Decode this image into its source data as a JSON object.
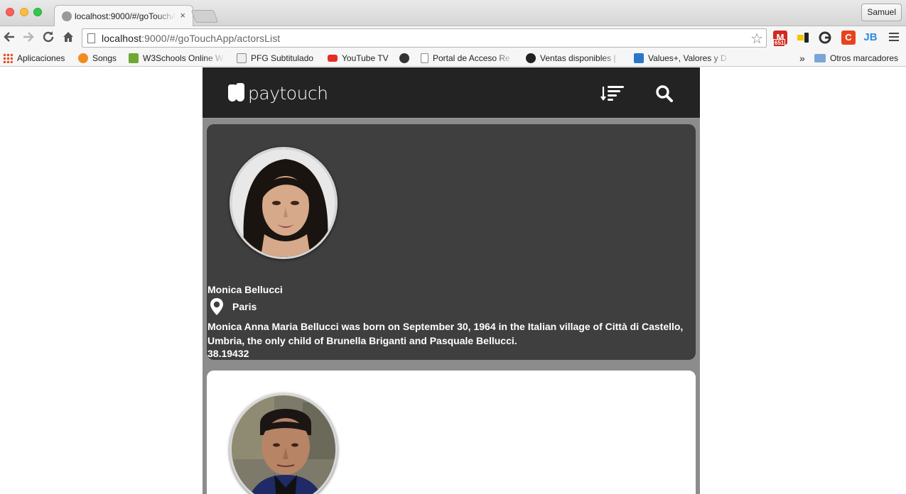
{
  "browser": {
    "tab_title": "localhost:9000/#/goTouchApp/actorsList",
    "tab_close": "×",
    "profile_name": "Samuel",
    "url_host": "localhost",
    "url_path": ":9000/#/goTouchApp/actorsList",
    "extensions": [
      {
        "name": "gmail-extension",
        "label": "M",
        "badge": "651",
        "color": "#d12a1f"
      },
      {
        "name": "hangouts-extension",
        "label": "",
        "color": "#f5c400"
      },
      {
        "name": "google-extension",
        "label": "G",
        "color": "#444444"
      },
      {
        "name": "c-extension",
        "label": "C",
        "color": "#e8431c"
      },
      {
        "name": "jb-extension",
        "label": "JB",
        "color": "#2b8cdf"
      }
    ]
  },
  "bookmarks": [
    {
      "label": "Aplicaciones",
      "icon": "apps-icon",
      "color": "#e44d26"
    },
    {
      "label": "Songs",
      "icon": "songs-icon",
      "color": "#f28b1e"
    },
    {
      "label": "W3Schools Online W",
      "icon": "w3schools-icon",
      "color": "#6fa832"
    },
    {
      "label": "PFG Subtitulado",
      "icon": "pfg-icon",
      "color": "#8a8a8a"
    },
    {
      "label": "YouTube TV",
      "icon": "youtube-icon",
      "color": "#e52d27"
    },
    {
      "label": "",
      "icon": "c-icon",
      "color": "#333333"
    },
    {
      "label": "Portal de Acceso Re",
      "icon": "page-icon",
      "color": "#ffffff"
    },
    {
      "label": "Ventas disponibles |",
      "icon": "ventas-icon",
      "color": "#222222"
    },
    {
      "label": "Values+, Valores y D",
      "icon": "values-icon",
      "color": "#2a77c8"
    },
    {
      "label": "»",
      "icon": "",
      "color": ""
    },
    {
      "label": "Otros marcadores",
      "icon": "folder-icon",
      "color": "#7aa6d6"
    }
  ],
  "app": {
    "brand": "paytouch",
    "actors": [
      {
        "name": "Monica Bellucci",
        "city": "Paris",
        "bio": "Monica Anna Maria Bellucci was born on September 30, 1964 in the Italian village of Città di Castello, Umbria, the only child of Brunella Briganti and Pasquale Bellucci.",
        "rating": "38.19432"
      },
      {
        "name": "",
        "city": "",
        "bio": "",
        "rating": ""
      }
    ]
  }
}
